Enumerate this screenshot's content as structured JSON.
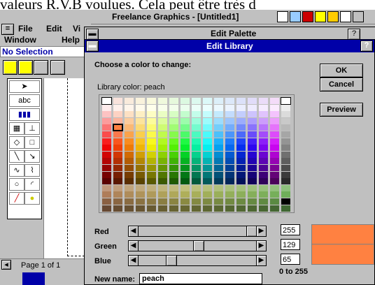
{
  "overlay_text": "valeurs R.V.B voulues. Cela peut être très d",
  "app": {
    "title": "Freelance Graphics - [Untitled1]",
    "menu": {
      "file": "File",
      "edit": "Edit",
      "view": "Vi",
      "window": "Window",
      "help": "Help"
    },
    "selection_status": "No Selection",
    "page_indicator": "Page 1 of 1",
    "tool_text": "abc"
  },
  "palette_dialog": {
    "title": "Edit Palette",
    "help": "?"
  },
  "library_dialog": {
    "title": "Edit Library",
    "help": "?",
    "choose_label": "Choose a color to change:",
    "library_color_label": "Library color: peach",
    "buttons": {
      "ok": "OK",
      "cancel": "Cancel",
      "preview": "Preview"
    },
    "sliders": [
      {
        "label": "Red",
        "value": "255",
        "level": 1.0
      },
      {
        "label": "Green",
        "value": "129",
        "level": 0.506
      },
      {
        "label": "Blue",
        "value": "65",
        "level": 0.255
      }
    ],
    "range_label": "0 to 255",
    "new_name_label": "New name:",
    "new_name_value": "peach",
    "current_color": "#FF8141"
  },
  "colors": {
    "title_active": "#0000A8",
    "face": "#C0C0C0"
  }
}
